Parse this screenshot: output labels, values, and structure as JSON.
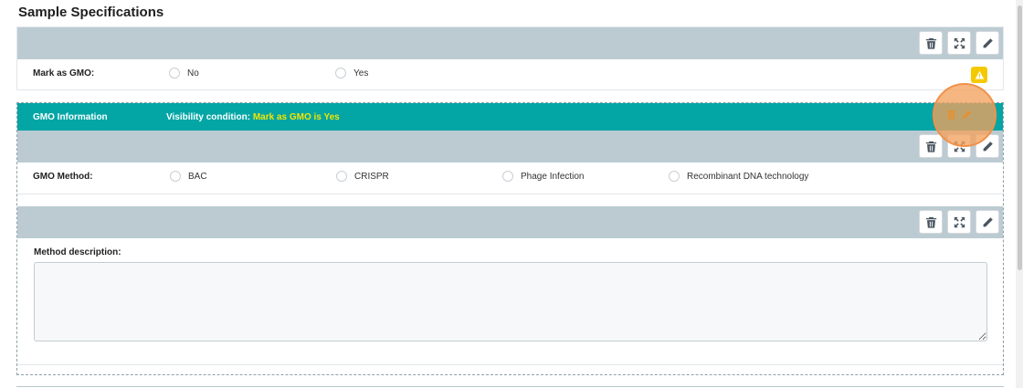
{
  "page": {
    "title": "Sample Specifications"
  },
  "gmo_field": {
    "label": "Mark as GMO:",
    "options": [
      "No",
      "Yes"
    ],
    "warning_icon": "warning-triangle-icon"
  },
  "group": {
    "title": "GMO Information",
    "condition_label": "Visibility condition:",
    "condition_value": "Mark as GMO is Yes"
  },
  "method_field": {
    "label": "GMO Method:",
    "options": [
      "BAC",
      "CRISPR",
      "Phage Infection",
      "Recombinant DNA technology"
    ]
  },
  "description_field": {
    "label": "Method description:",
    "value": ""
  },
  "toolbar": {
    "icons": [
      "trash-icon",
      "expand-icon",
      "pencil-icon"
    ]
  },
  "colors": {
    "panel_header": "#bccbd2",
    "group_header": "#03a5a5",
    "condition_value": "#f3e600",
    "warning": "#f5c900",
    "highlight": "#f4a15e"
  }
}
